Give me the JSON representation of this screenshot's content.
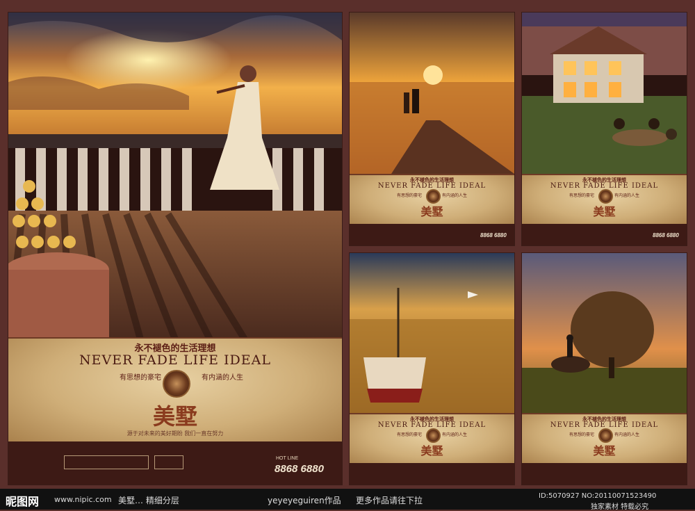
{
  "common": {
    "slogan_cn": "永不褪色的生活理想",
    "slogan_en": "NEVER FADE LIFE IDEAL",
    "sub_left": "有思想的豪宅",
    "sub_right": "有内涵的人生",
    "brand": "美墅",
    "tagline": "源于对未来的美好期盼 我们一直在努力",
    "hotline_label": "HOT LINE",
    "hotline": "8868 6880"
  },
  "colors": {
    "accent": "#5b1d14",
    "parchment": "#d8ba86",
    "frame": "#5a2f2b"
  },
  "bottom": {
    "logo": "昵图网",
    "logo_url": "www.nipic.com",
    "left_text": "美墅… 精细分层",
    "author": "yeyeyeguiren作品",
    "more": "更多作品请往下拉",
    "id_text": "ID:5070927 NO:20110071523490",
    "right_text": "独家素材 特载必究"
  }
}
